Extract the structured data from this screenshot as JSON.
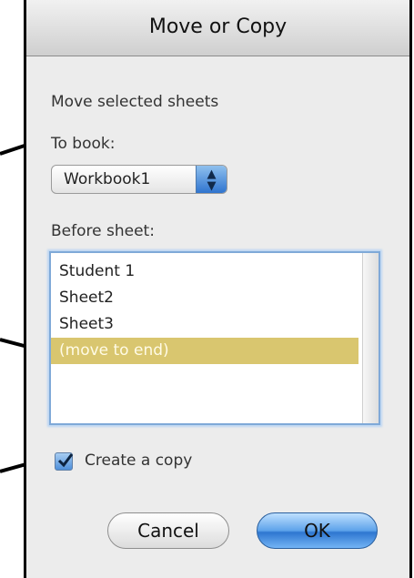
{
  "dialog": {
    "title": "Move or Copy",
    "instruction": "Move selected sheets",
    "to_book_label": "To book:",
    "book_select": {
      "value": "Workbook1"
    },
    "before_sheet_label": "Before sheet:",
    "sheets": [
      "Student 1",
      "Sheet2",
      "Sheet3",
      "(move to end)"
    ],
    "selected_sheet": "(move to end)",
    "create_copy": {
      "label": "Create a copy",
      "checked": true
    },
    "buttons": {
      "cancel": "Cancel",
      "ok": "OK"
    },
    "colors": {
      "selection": "#d9c66f",
      "accent": "#3a7fd4"
    }
  }
}
